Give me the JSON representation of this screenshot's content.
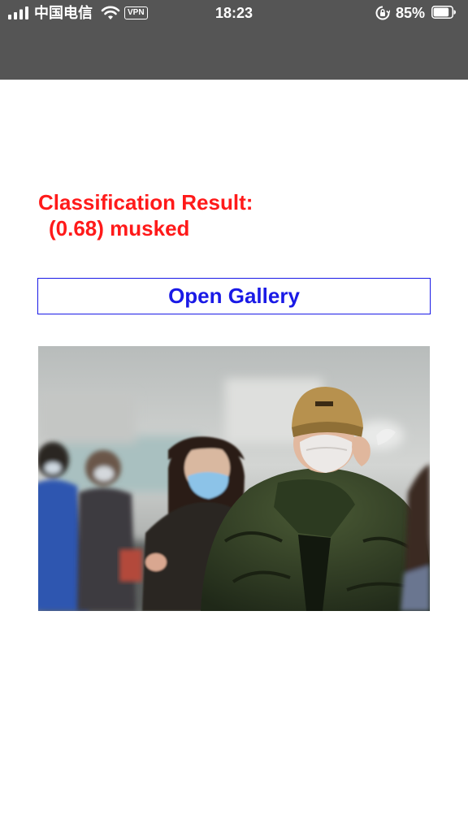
{
  "status_bar": {
    "carrier": "中国电信",
    "vpn": "VPN",
    "time": "18:23",
    "battery": "85%",
    "battery_level": 0.85,
    "background_color": "#555555"
  },
  "result": {
    "heading": "Classification Result:",
    "value": "(0.68) musked",
    "color": "#ff1a1a"
  },
  "actions": {
    "open_gallery_label": "Open Gallery",
    "button_color": "#1a1ae6"
  },
  "photo": {
    "subject": "people-wearing-face-masks"
  }
}
